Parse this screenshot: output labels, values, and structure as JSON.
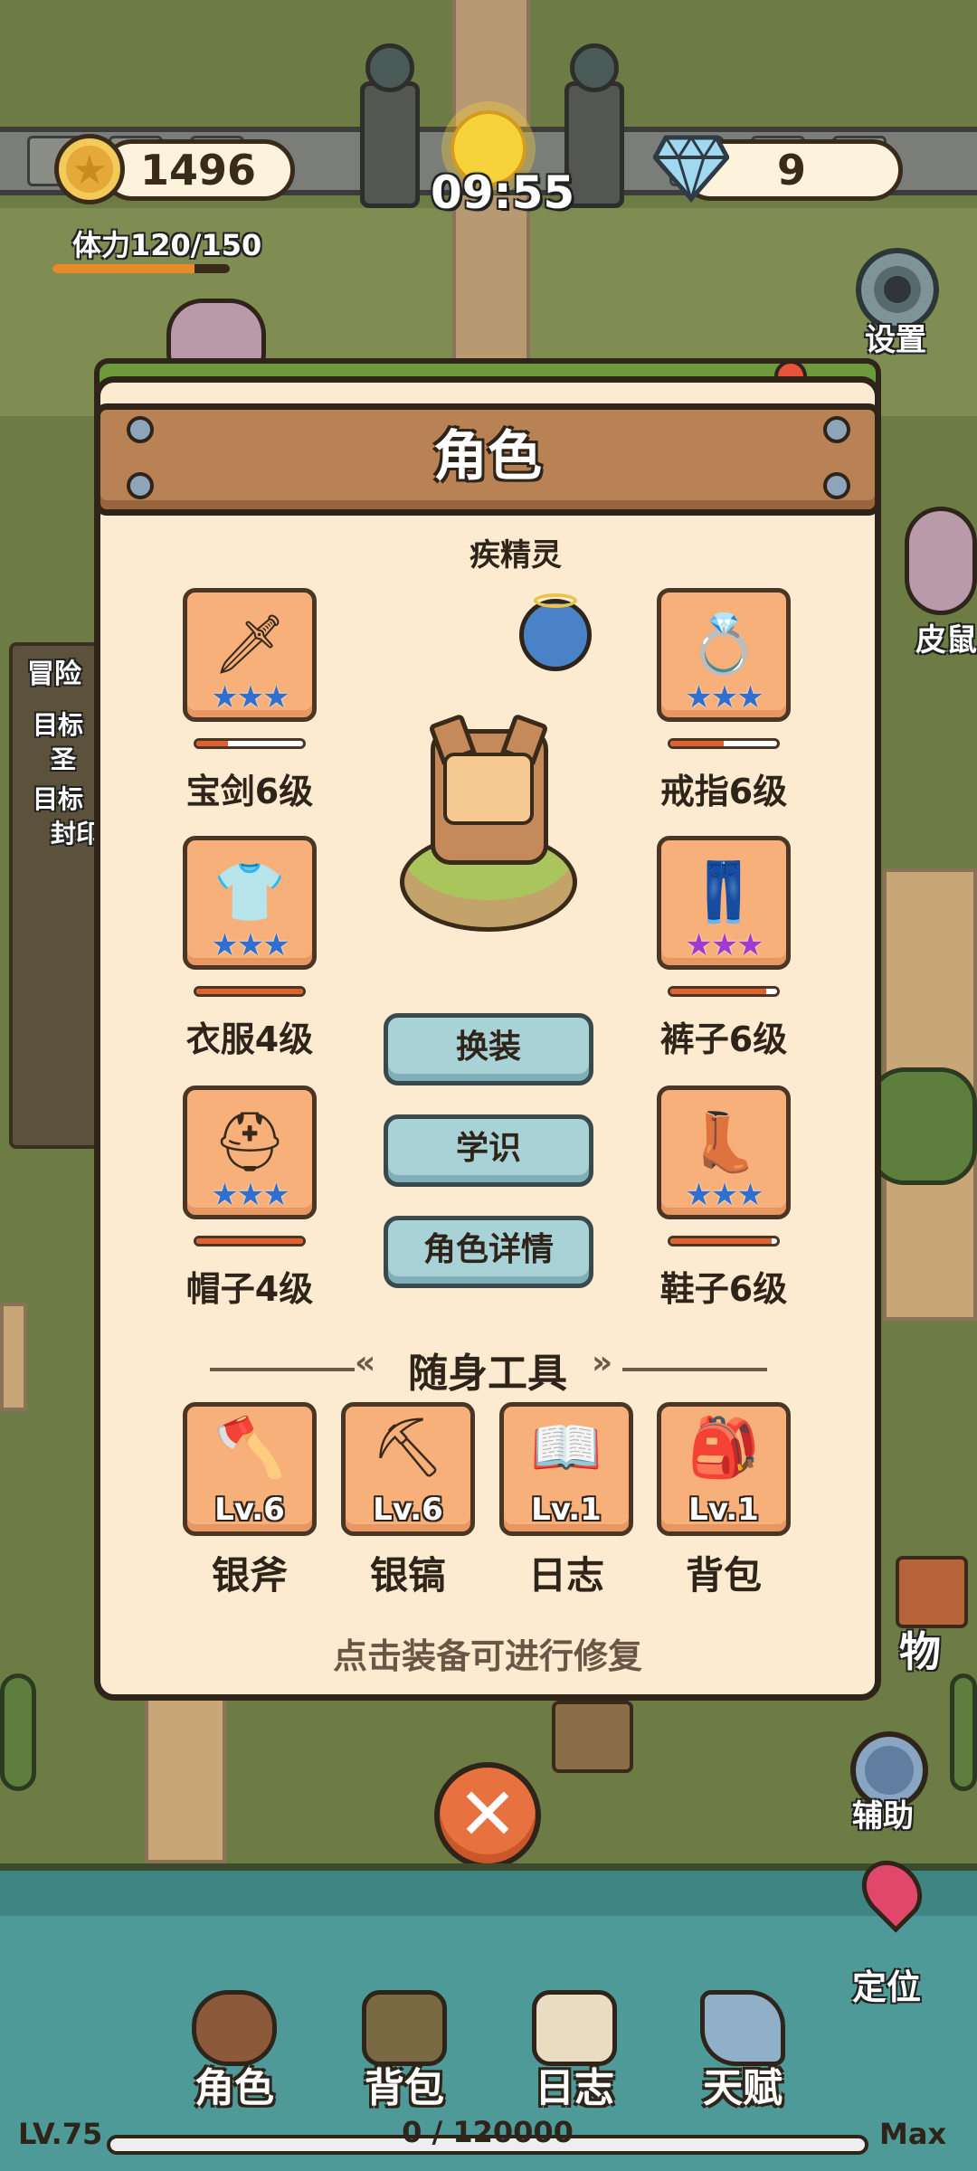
{
  "hud": {
    "coins": "1496",
    "time": "09:55",
    "gems": "9",
    "stamina_text": "体力120/150",
    "stamina_fraction": 0.8,
    "settings_label": "设置"
  },
  "background": {
    "left_labels": [
      "冒险",
      "目标",
      "圣",
      "目标",
      "封印"
    ],
    "right_labels": [
      "皮鼠",
      "物",
      "辅助",
      "定位"
    ]
  },
  "panel": {
    "title": "角色",
    "spirit_name": "疾精灵",
    "equipment": [
      {
        "slot": "sword",
        "label": "宝剑6级",
        "icon": "🗡",
        "stars": 3,
        "star_color": "blue",
        "durability": 0.3
      },
      {
        "slot": "ring",
        "label": "戒指6级",
        "icon": "💍",
        "stars": 3,
        "star_color": "blue",
        "durability": 0.5
      },
      {
        "slot": "clothes",
        "label": "衣服4级",
        "icon": "👕",
        "stars": 3,
        "star_color": "blue",
        "durability": 1.0
      },
      {
        "slot": "pants",
        "label": "裤子6级",
        "icon": "👖",
        "stars": 3,
        "star_color": "purple",
        "durability": 0.9
      },
      {
        "slot": "hat",
        "label": "帽子4级",
        "icon": "⛑",
        "stars": 3,
        "star_color": "blue",
        "durability": 1.0
      },
      {
        "slot": "shoes",
        "label": "鞋子6级",
        "icon": "👢",
        "stars": 3,
        "star_color": "blue",
        "durability": 0.95
      }
    ],
    "buttons": {
      "change_outfit": "换装",
      "knowledge": "学识",
      "character_details": "角色详情"
    },
    "tools_title": "随身工具",
    "tools": [
      {
        "name": "银斧",
        "level": "Lv.6",
        "icon": "🪓"
      },
      {
        "name": "银镐",
        "level": "Lv.6",
        "icon": "⛏"
      },
      {
        "name": "日志",
        "level": "Lv.1",
        "icon": "📖"
      },
      {
        "name": "背包",
        "level": "Lv.1",
        "icon": "🎒"
      }
    ],
    "hint": "点击装备可进行修复",
    "close_symbol": "✕"
  },
  "bottom_nav": {
    "items": [
      {
        "label": "角色"
      },
      {
        "label": "背包"
      },
      {
        "label": "日志"
      },
      {
        "label": "天赋"
      }
    ],
    "level": "LV.75",
    "xp_text": "0 / 120000",
    "max": "Max",
    "xp_fraction": 0.0
  },
  "colors": {
    "panel_bg": "#fcebd1",
    "slot_orange": "#f8b07a",
    "button_teal": "#a8d2d6",
    "close_orange": "#e7723f",
    "water": "#4e9a98"
  }
}
